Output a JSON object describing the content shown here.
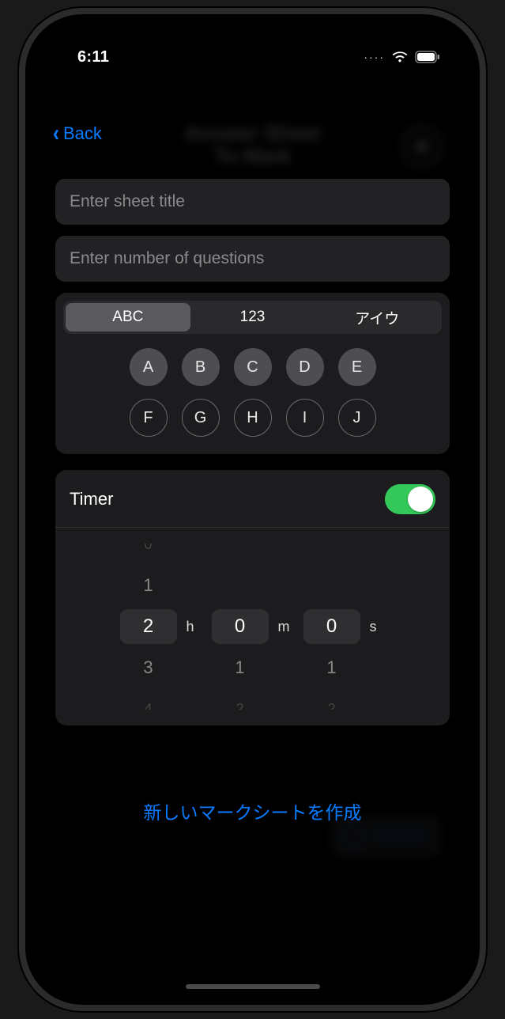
{
  "status": {
    "time": "6:11",
    "cell": "····"
  },
  "nav": {
    "back": "Back"
  },
  "bg": {
    "title_line1": "Answer Sheet",
    "title_line2": "To Mark"
  },
  "form": {
    "title_placeholder": "Enter sheet title",
    "count_placeholder": "Enter number of questions"
  },
  "seg": {
    "items": [
      "ABC",
      "123",
      "アイウ"
    ],
    "selected_index": 0
  },
  "letters": {
    "row1": [
      "A",
      "B",
      "C",
      "D",
      "E"
    ],
    "row2": [
      "F",
      "G",
      "H",
      "I",
      "J"
    ],
    "row1_filled": true
  },
  "timer": {
    "label": "Timer",
    "on": true,
    "h": 2,
    "m": 0,
    "s": 0,
    "h_unit": "h",
    "m_unit": "m",
    "s_unit": "s"
  },
  "create": {
    "label": "新しいマークシートを作成"
  }
}
